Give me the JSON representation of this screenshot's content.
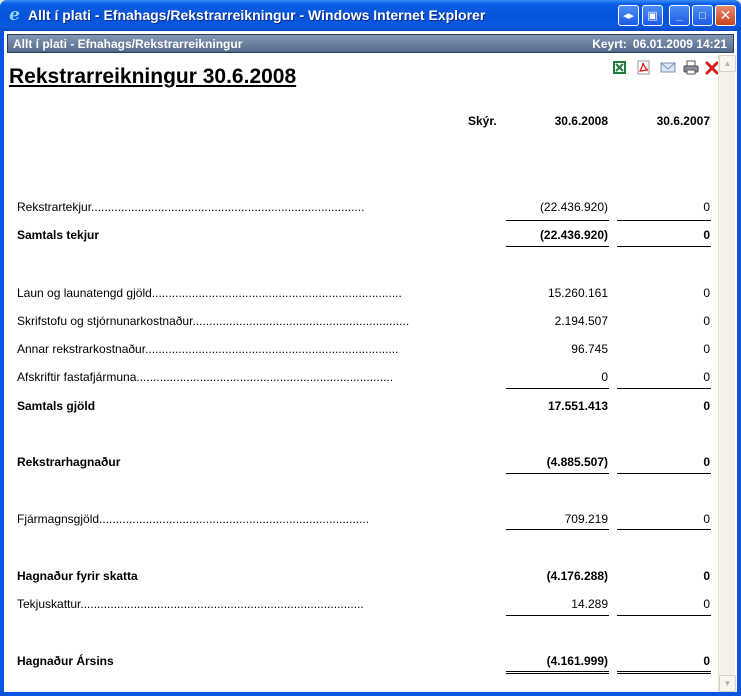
{
  "window": {
    "title": "Allt í plati - Efnahags/Rekstrarreikningur - Windows Internet Explorer",
    "buttons": {
      "restore_glyph": "◂▸",
      "new_glyph": "▣",
      "minimize_glyph": "_",
      "maximize_glyph": "□",
      "close_glyph": "✕"
    }
  },
  "report_bar": {
    "left_text": "Allt í plati - Efnahags/Rekstrarreikningur",
    "run_label": "Keyrt:",
    "run_value": "06.01.2009 14:21"
  },
  "page_title": "Rekstrarreikningur 30.6.2008",
  "toolbar": {
    "icons": [
      "excel-icon",
      "pdf-icon",
      "email-icon",
      "print-icon",
      "close-icon"
    ]
  },
  "columns": {
    "note": "Skýr.",
    "current": "30.6.2008",
    "previous": "30.6.2007"
  },
  "rows": [
    {
      "label": "Rekstrartekjur",
      "dots": "..................................................................................",
      "current": "(22.436.920)",
      "previous": "0"
    },
    {
      "label": "Samtals tekjur",
      "dots": "",
      "current": "(22.436.920)",
      "previous": "0"
    },
    {
      "label": "Laun og launatengd gjöld",
      "dots": "...........................................................................",
      "current": "15.260.161",
      "previous": "0"
    },
    {
      "label": "Skrifstofu og stjórnunarkostnaður",
      "dots": ".................................................................",
      "current": "2.194.507",
      "previous": "0"
    },
    {
      "label": "Annar rekstrarkostnaður",
      "dots": "............................................................................",
      "current": "96.745",
      "previous": "0"
    },
    {
      "label": "Afskriftir fastafjármuna",
      "dots": ".............................................................................",
      "current": "0",
      "previous": "0"
    },
    {
      "label": "Samtals gjöld",
      "dots": "",
      "current": "17.551.413",
      "previous": "0"
    },
    {
      "label": "Rekstrarhagnaður",
      "dots": "",
      "current": "(4.885.507)",
      "previous": "0"
    },
    {
      "label": "Fjármagnsgjöld",
      "dots": ".................................................................................",
      "current": "709.219",
      "previous": "0"
    },
    {
      "label": "Hagnaður fyrir skatta",
      "dots": "",
      "current": "(4.176.288)",
      "previous": "0"
    },
    {
      "label": "Tekjuskattur",
      "dots": ".....................................................................................",
      "current": "14.289",
      "previous": "0"
    },
    {
      "label": "Hagnaður Ársins",
      "dots": "",
      "current": "(4.161.999)",
      "previous": "0"
    }
  ],
  "scrollbar": {
    "up_glyph": "▲",
    "down_glyph": "▼"
  }
}
